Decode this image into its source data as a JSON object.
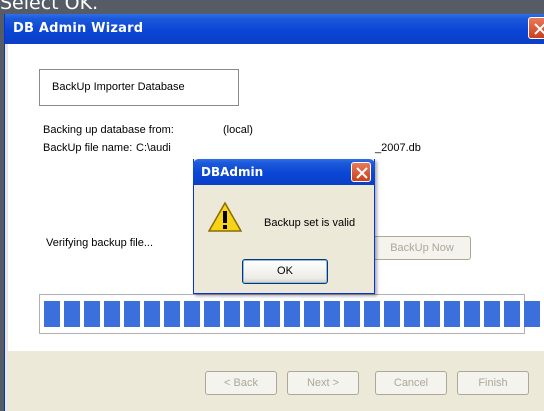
{
  "caption": "Select OK.",
  "wizard": {
    "title": "DB Admin Wizard",
    "header": "BackUp Importer Database",
    "backing_up_label": "Backing up database from:",
    "backing_up_value": "(local)",
    "file_name_label": "BackUp file name:",
    "file_name_value_left": "C:\\audi",
    "file_name_value_right": "_2007.db",
    "status": "Verifying backup file...",
    "backup_now_label": "BackUp Now",
    "progress": {
      "segments_filled": 27,
      "percent": 100
    },
    "buttons": {
      "back": "< Back",
      "next": "Next >",
      "cancel": "Cancel",
      "finish": "Finish"
    }
  },
  "dialog": {
    "title": "DBAdmin",
    "message": "Backup set is valid",
    "ok_label": "OK",
    "icon": "warning-icon"
  },
  "colors": {
    "title_bar": "#0a46d6",
    "progress": "#3b6fdb",
    "close_button": "#c9401e",
    "dialog_bg": "#ece9d8"
  }
}
